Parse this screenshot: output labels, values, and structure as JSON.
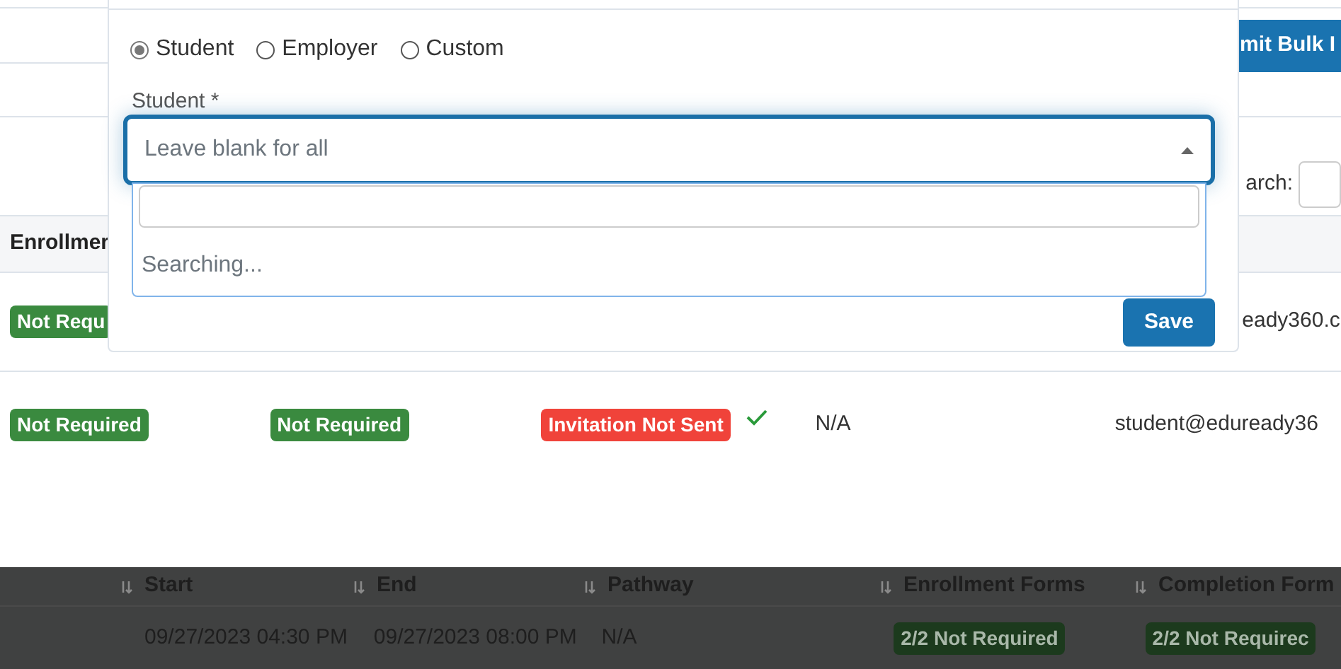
{
  "background_page": {
    "bulk_button": "mit Bulk I",
    "search_label": "arch:",
    "table": {
      "columns": [
        "Enrollmer"
      ],
      "rows": [
        {
          "cells": [
            {
              "kind": "badge",
              "text": "Not Requ",
              "color": "#3a8a3f"
            },
            {
              "kind": "empty"
            },
            {
              "kind": "empty"
            },
            {
              "kind": "empty"
            },
            {
              "kind": "empty"
            },
            {
              "kind": "text",
              "text": "eady360.c"
            }
          ]
        },
        {
          "cells": [
            {
              "kind": "badge",
              "text": "Not Required",
              "color": "#3a8a3f"
            },
            {
              "kind": "badge",
              "text": "Not Required",
              "color": "#3a8a3f"
            },
            {
              "kind": "badge",
              "text": "Invitation Not Sent",
              "color": "#f0433a"
            },
            {
              "kind": "check"
            },
            {
              "kind": "text",
              "text": "N/A"
            },
            {
              "kind": "text",
              "text": "student@eduready36"
            }
          ]
        }
      ]
    }
  },
  "modal": {
    "recipient_types": [
      {
        "label": "Student",
        "selected": true
      },
      {
        "label": "Employer",
        "selected": false
      },
      {
        "label": "Custom",
        "selected": false
      }
    ],
    "field_label": "Student *",
    "select": {
      "placeholder": "Leave blank for all",
      "expanded": true
    },
    "dropdown_status": "Searching...",
    "save_button": "Save"
  },
  "lower_page": {
    "columns": [
      "Start",
      "End",
      "Pathway",
      "Enrollment Forms",
      "Completion Form"
    ],
    "rows": [
      {
        "cells": [
          {
            "kind": "text",
            "text": "09/27/2023 04:30 PM"
          },
          {
            "kind": "text",
            "text": "09/27/2023 08:00 PM"
          },
          {
            "kind": "text",
            "text": "N/A"
          },
          {
            "kind": "badge",
            "text": "2/2 Not Required",
            "color": "#1c3a1d"
          },
          {
            "kind": "badge",
            "text": "2/2 Not Requirec",
            "color": "#1c3a1d"
          }
        ]
      }
    ]
  }
}
